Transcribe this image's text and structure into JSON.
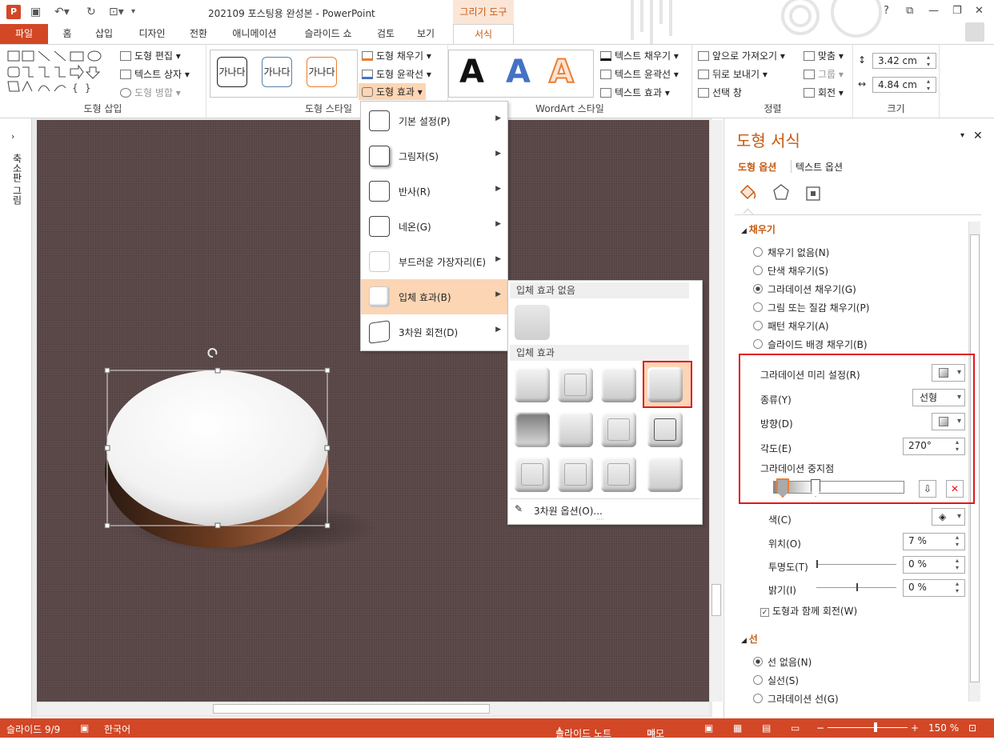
{
  "titlebar": {
    "title": "202109 포스팅용 완성본 - PowerPoint",
    "context_tab": "그리기 도구",
    "help": "?",
    "app_icon": "P"
  },
  "tabs": [
    "파일",
    "홈",
    "삽입",
    "디자인",
    "전환",
    "애니메이션",
    "슬라이드 쇼",
    "검토",
    "보기",
    "서식"
  ],
  "ribbon": {
    "insert_shapes": {
      "label": "도형 삽입",
      "edit_shape": "도형 편집",
      "text_box": "텍스트 상자",
      "merge_shapes": "도형 병합"
    },
    "shape_styles": {
      "label": "도형 스타일",
      "sample": "가나다",
      "fill": "도형 채우기",
      "outline": "도형 윤곽선",
      "effects": "도형 효과"
    },
    "wordart": {
      "label": "WordArt 스타일",
      "letter": "A",
      "text_fill": "텍스트 채우기",
      "text_outline": "텍스트 윤곽선",
      "text_effects": "텍스트 효과"
    },
    "arrange": {
      "label": "정렬",
      "bring_forward": "앞으로 가져오기",
      "send_backward": "뒤로 보내기",
      "selection_pane": "선택 창",
      "align": "맞춤",
      "group": "그룹",
      "rotate": "회전"
    },
    "size": {
      "label": "크기",
      "height": "3.42 cm",
      "width": "4.84 cm"
    }
  },
  "leftpane": {
    "label": "축소판 그림"
  },
  "effects_menu": {
    "items": [
      "기본 설정(P)",
      "그림자(S)",
      "반사(R)",
      "네온(G)",
      "부드러운 가장자리(E)",
      "입체 효과(B)",
      "3차원 회전(D)"
    ]
  },
  "bevel_submenu": {
    "no_bevel": "입체 효과 없음",
    "bevel": "입체 효과",
    "options": "3차원 옵션(O)..."
  },
  "format_pane": {
    "title": "도형 서식",
    "tab_shape": "도형 옵션",
    "tab_text": "텍스트 옵션",
    "fill_section": "채우기",
    "fill_options": [
      "채우기 없음(N)",
      "단색 채우기(S)",
      "그라데이션 채우기(G)",
      "그림 또는 질감 채우기(P)",
      "패턴 채우기(A)",
      "슬라이드 배경 채우기(B)"
    ],
    "preset": "그라데이션 미리 설정(R)",
    "type": "종류(Y)",
    "type_value": "선형",
    "direction": "방향(D)",
    "angle": "각도(E)",
    "angle_value": "270°",
    "stops": "그라데이션 중지점",
    "color": "색(C)",
    "position": "위치(O)",
    "position_value": "7 %",
    "transparency": "투명도(T)",
    "transparency_value": "0 %",
    "brightness": "밝기(I)",
    "brightness_value": "0 %",
    "rotate_with": "도형과 함께 회전(W)",
    "line_section": "선",
    "line_options": [
      "선 없음(N)",
      "실선(S)",
      "그라데이션 선(G)"
    ]
  },
  "status": {
    "slide": "슬라이드 9/9",
    "lang": "한국어",
    "notes": "슬라이드 노트",
    "comments": "메모",
    "zoom": "150 %"
  },
  "colors": {
    "accent": "#d24726",
    "slide_bg": "#5e4b4b",
    "highlight": "#fcd5b4",
    "red_box": "#e3161c"
  }
}
